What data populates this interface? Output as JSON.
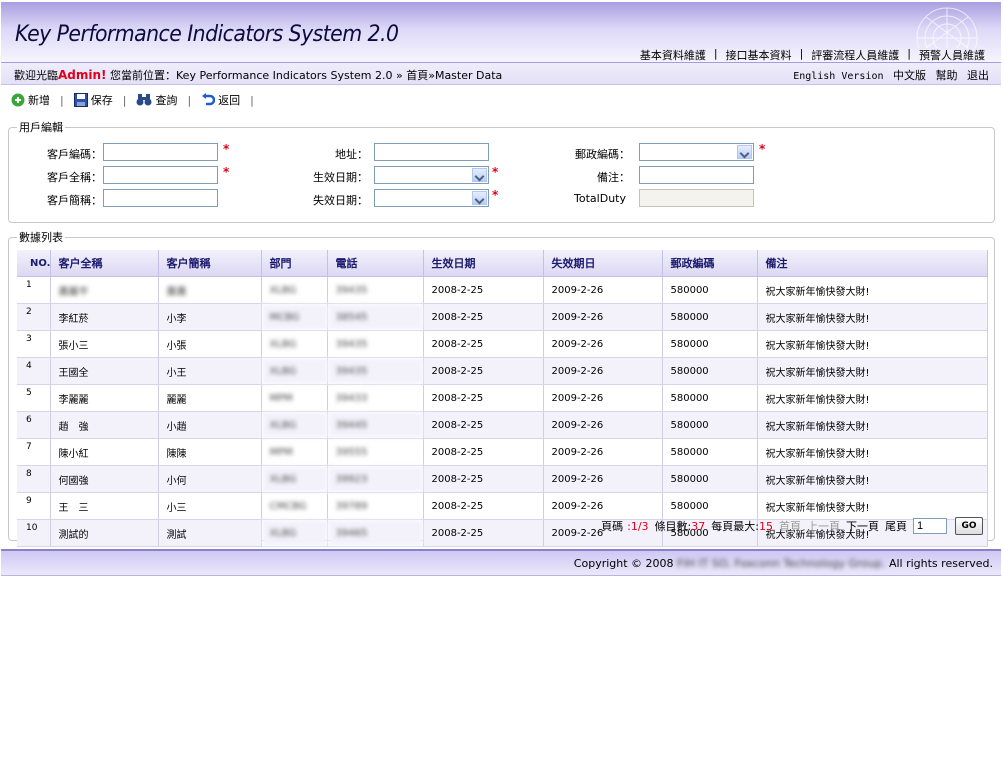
{
  "app": {
    "title": "Key Performance Indicators System 2.0",
    "nav": [
      "基本資料維護",
      "接口基本資料",
      "評審流程人員維護",
      "預警人員維護"
    ]
  },
  "welcome": {
    "prefix": "歡迎光臨",
    "user": "Admin!",
    "location_label": "您當前位置：",
    "location": "Key Performance Indicators System 2.0 » 首頁»Master Data",
    "links": {
      "english": "English Version",
      "chinese": "中文版",
      "help": "幫助",
      "exit": "退出"
    }
  },
  "toolbar": {
    "add": "新增",
    "save": "保存",
    "query": "查詢",
    "back": "返回"
  },
  "form": {
    "legend": "用戶編輯",
    "customer_code": "客戶編碼：",
    "customer_fullname": "客戶全稱：",
    "customer_shortname": "客戶簡稱：",
    "address": "地址：",
    "effective_date": "生效日期：",
    "expiry_date": "失效日期：",
    "postal_code": "郵政編碼：",
    "remark": "備注：",
    "total_duty": "TotalDuty",
    "required_mark": "*"
  },
  "list": {
    "legend": "數據列表",
    "columns": [
      "NO.",
      "客户全稱",
      "客户簡稱",
      "部門",
      "電話",
      "生效日期",
      "失效期日",
      "郵政編碼",
      "備注"
    ],
    "rows": [
      {
        "no": "1",
        "full": "蕭麗平",
        "short": "蕭蕭",
        "dept": "XLBG",
        "phone": "39435",
        "start": "2008-2-25",
        "end": "2009-2-26",
        "zip": "580000",
        "remark": "祝大家新年愉快發大財!"
      },
      {
        "no": "2",
        "full": "李紅菸",
        "short": "小李",
        "dept": "MCBG",
        "phone": "38545",
        "start": "2008-2-25",
        "end": "2009-2-26",
        "zip": "580000",
        "remark": "祝大家新年愉快發大財!"
      },
      {
        "no": "3",
        "full": "張小三",
        "short": "小張",
        "dept": "XLBG",
        "phone": "39435",
        "start": "2008-2-25",
        "end": "2009-2-26",
        "zip": "580000",
        "remark": "祝大家新年愉快發大財!"
      },
      {
        "no": "4",
        "full": "王國全",
        "short": "小王",
        "dept": "XLBG",
        "phone": "39435",
        "start": "2008-2-25",
        "end": "2009-2-26",
        "zip": "580000",
        "remark": "祝大家新年愉快發大財!"
      },
      {
        "no": "5",
        "full": "李麗麗",
        "short": "麗麗",
        "dept": "MPM",
        "phone": "39433",
        "start": "2008-2-25",
        "end": "2009-2-26",
        "zip": "580000",
        "remark": "祝大家新年愉快發大財!"
      },
      {
        "no": "6",
        "full": "趙　強",
        "short": "小趙",
        "dept": "XLBG",
        "phone": "39445",
        "start": "2008-2-25",
        "end": "2009-2-26",
        "zip": "580000",
        "remark": "祝大家新年愉快發大財!"
      },
      {
        "no": "7",
        "full": "陳小紅",
        "short": "陳陳",
        "dept": "MPM",
        "phone": "39555",
        "start": "2008-2-25",
        "end": "2009-2-26",
        "zip": "580000",
        "remark": "祝大家新年愉快發大財!"
      },
      {
        "no": "8",
        "full": "何國強",
        "short": "小何",
        "dept": "XLBG",
        "phone": "39923",
        "start": "2008-2-25",
        "end": "2009-2-26",
        "zip": "580000",
        "remark": "祝大家新年愉快發大財!"
      },
      {
        "no": "9",
        "full": "王　三",
        "short": "小三",
        "dept": "CMCBG",
        "phone": "39789",
        "start": "2008-2-25",
        "end": "2009-2-26",
        "zip": "580000",
        "remark": "祝大家新年愉快發大財!"
      },
      {
        "no": "10",
        "full": "測試的",
        "short": "測試",
        "dept": "XLBG",
        "phone": "39465",
        "start": "2008-2-25",
        "end": "2009-2-26",
        "zip": "580000",
        "remark": "祝大家新年愉快發大財!"
      }
    ]
  },
  "pager": {
    "page_label": "頁碼",
    "page_value": ":1/3",
    "count_label": "條目數:",
    "count_value": "37",
    "max_label": "每頁最大:",
    "max_value": "15",
    "first": "首頁",
    "prev": "上一頁",
    "next": "下一頁",
    "last": "尾頁",
    "page_input": "1",
    "go": "GO"
  },
  "footer": {
    "prefix": "Copyright © 2008",
    "company": "FIH IT SO, Foxconn Technology Group.",
    "suffix": "All rights reserved."
  },
  "colors": {
    "accent": "#9c8fdc",
    "required": "#e0001b",
    "header_text": "#1b1a6e"
  }
}
